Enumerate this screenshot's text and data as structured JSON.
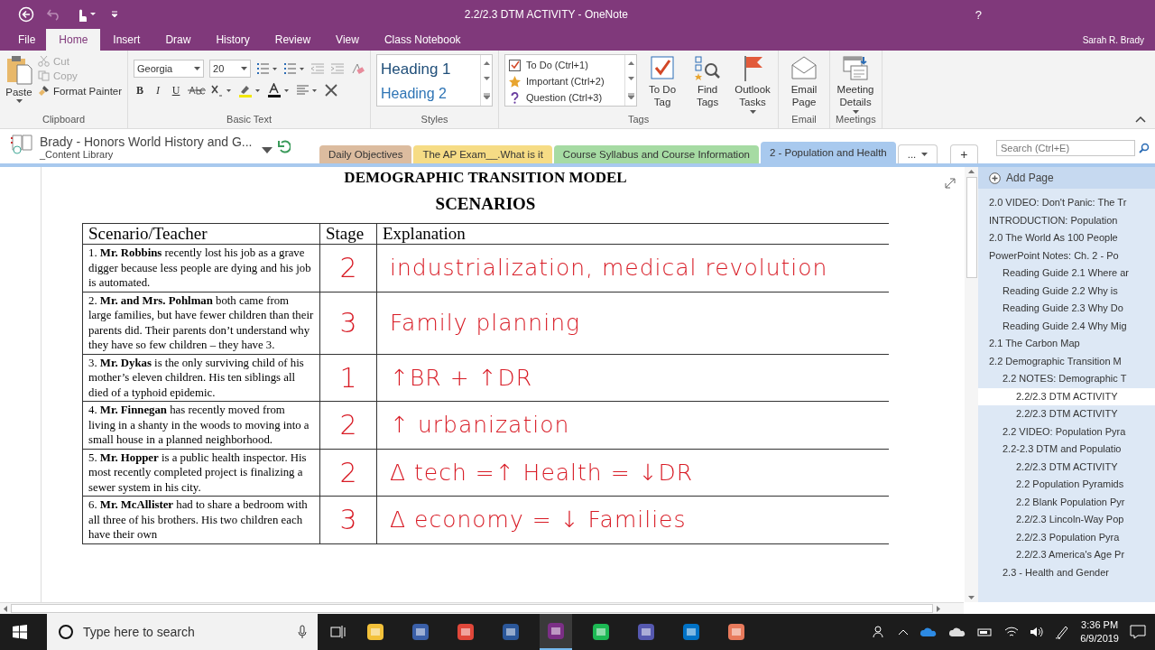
{
  "window": {
    "title": "2.2/2.3 DTM ACTIVITY - OneNote",
    "help": "?",
    "user": "Sarah R. Brady"
  },
  "ribbon_tabs": [
    {
      "label": "File",
      "selected": false
    },
    {
      "label": "Home",
      "selected": true
    },
    {
      "label": "Insert",
      "selected": false
    },
    {
      "label": "Draw",
      "selected": false
    },
    {
      "label": "History",
      "selected": false
    },
    {
      "label": "Review",
      "selected": false
    },
    {
      "label": "View",
      "selected": false
    },
    {
      "label": "Class Notebook",
      "selected": false
    }
  ],
  "clipboard": {
    "label": "Clipboard",
    "paste": "Paste",
    "cut": {
      "label": "Cut",
      "disabled": true
    },
    "copy": {
      "label": "Copy",
      "disabled": true
    },
    "format_painter": {
      "label": "Format Painter",
      "disabled": false
    }
  },
  "basic_text": {
    "label": "Basic Text",
    "font": "Georgia",
    "size": "20",
    "format_buttons": [
      {
        "kind": "bold",
        "label": "B"
      },
      {
        "kind": "italic",
        "label": "I"
      },
      {
        "kind": "underline",
        "label": "U"
      }
    ]
  },
  "styles": {
    "label": "Styles",
    "items": [
      "Heading 1",
      "Heading 2"
    ]
  },
  "tags": {
    "label": "Tags",
    "items": [
      {
        "kind": "checkbox",
        "label": "To Do (Ctrl+1)"
      },
      {
        "kind": "star",
        "label": "Important (Ctrl+2)"
      },
      {
        "kind": "question",
        "label": "Question (Ctrl+3)"
      }
    ],
    "buttons": [
      {
        "kind": "todo",
        "label": "To Do Tag"
      },
      {
        "kind": "find",
        "label": "Find Tags"
      },
      {
        "kind": "flag",
        "label": "Outlook Tasks"
      }
    ]
  },
  "email": {
    "label": "Email",
    "button": "Email Page"
  },
  "meetings": {
    "label": "Meetings",
    "button": "Meeting Details"
  },
  "notebook": {
    "name": "Brady - Honors World History and G...",
    "section_group": "_Content Library"
  },
  "sections": [
    {
      "label": "Daily Objectives",
      "color": "#dcbc9f",
      "selected": false
    },
    {
      "label": "The AP Exam__.What is it",
      "color": "#f6dc85",
      "selected": false
    },
    {
      "label": "Course Syllabus and Course Information",
      "color": "#a6dba3",
      "selected": false
    },
    {
      "label": "2 - Population and Health",
      "color": "#a8c9ee",
      "selected": true
    }
  ],
  "more_sections": "...",
  "add_section": "+",
  "search": {
    "placeholder": "Search (Ctrl+E)"
  },
  "page": {
    "title_lines": [
      "DEMOGRAPHIC TRANSITION MODEL",
      "SCENARIOS"
    ],
    "table": {
      "columns": [
        "Scenario/Teacher",
        "Stage",
        "Explanation"
      ],
      "rows": [
        {
          "scenario": "1. **Mr. Robbins** recently lost his job as a grave digger because less people are dying and his job is automated.",
          "stage": "2",
          "explanation": "industrialization, medical revolution"
        },
        {
          "scenario": "2. **Mr. and Mrs. Pohlman** both came from large families, but have fewer children than their parents did.  Their parents don’t understand why they have so few children – they have 3.",
          "stage": "3",
          "explanation": "Family planning"
        },
        {
          "scenario": "3. **Mr. Dykas** is the only surviving child of his mother’s eleven children.  His ten siblings all died of a typhoid epidemic.",
          "stage": "1",
          "explanation": "↑BR + ↑DR"
        },
        {
          "scenario": "4. **Mr. Finnegan** has recently moved from living in a shanty in the woods to moving into a small house in a planned neighborhood.",
          "stage": "2",
          "explanation": "↑ urbanization"
        },
        {
          "scenario": "5. **Mr. Hopper** is a public health inspector.  His most recently completed project is finalizing a sewer system in his city.",
          "stage": "2",
          "explanation": "Δ tech =↑ Health = ↓DR"
        },
        {
          "scenario": "6. **Mr. McAllister** had to share a bedroom with all three of his brothers.  His two children each have their own",
          "stage": "3",
          "explanation": "Δ economy = ↓ Families"
        }
      ]
    }
  },
  "pages": {
    "add": "Add Page",
    "items": [
      {
        "title": "2.0 VIDEO: Don't Panic: The Tr",
        "selected": false
      },
      {
        "title": "INTRODUCTION: Population",
        "selected": false
      },
      {
        "title": "2.0 The World As 100 People",
        "selected": false
      },
      {
        "title": "PowerPoint Notes:  Ch. 2 - Po",
        "selected": false,
        "children": [
          {
            "title": "Reading Guide 2.1 Where ar",
            "selected": false
          },
          {
            "title": "Reading Guide 2.2 Why is",
            "selected": false
          },
          {
            "title": "Reading Guide 2.3 Why Do",
            "selected": false
          },
          {
            "title": "Reading Guide 2.4 Why Mig",
            "selected": false
          }
        ]
      },
      {
        "title": "2.1 The Carbon Map",
        "selected": false
      },
      {
        "title": "2.2 Demographic Transition M",
        "selected": false,
        "children": [
          {
            "title": "2.2 NOTES: Demographic T",
            "selected": false,
            "children": [
              {
                "title": "2.2/2.3 DTM ACTIVITY",
                "selected": true
              },
              {
                "title": "2.2/2.3 DTM ACTIVITY",
                "selected": false
              }
            ]
          },
          {
            "title": "2.2 VIDEO: Population Pyra",
            "selected": false
          },
          {
            "title": "2.2-2.3 DTM and Populatio",
            "selected": false,
            "children": [
              {
                "title": "2.2/2.3 DTM ACTIVITY",
                "selected": false
              },
              {
                "title": "2.2 Population Pyramids",
                "selected": false
              },
              {
                "title": "2.2 Blank Population Pyr",
                "selected": false
              },
              {
                "title": "2.2/2.3 Lincoln-Way Pop",
                "selected": false
              },
              {
                "title": "2.2/2.3 Population Pyra",
                "selected": false
              },
              {
                "title": "2.2/2.3 America's Age Pr",
                "selected": false
              }
            ]
          },
          {
            "title": "2.3 - Health and Gender",
            "selected": false
          }
        ]
      }
    ]
  },
  "taskbar": {
    "search_placeholder": "Type here to search",
    "apps": [
      {
        "kind": "explorer",
        "selected": false
      },
      {
        "kind": "sky",
        "selected": false
      },
      {
        "kind": "chrome",
        "selected": false
      },
      {
        "kind": "word",
        "selected": false
      },
      {
        "kind": "onenote",
        "selected": true
      },
      {
        "kind": "spotify",
        "selected": false
      },
      {
        "kind": "teams",
        "selected": false
      },
      {
        "kind": "outlook",
        "selected": false
      },
      {
        "kind": "photos",
        "selected": false
      }
    ],
    "time": "3:36 PM",
    "date": "6/9/2019"
  }
}
